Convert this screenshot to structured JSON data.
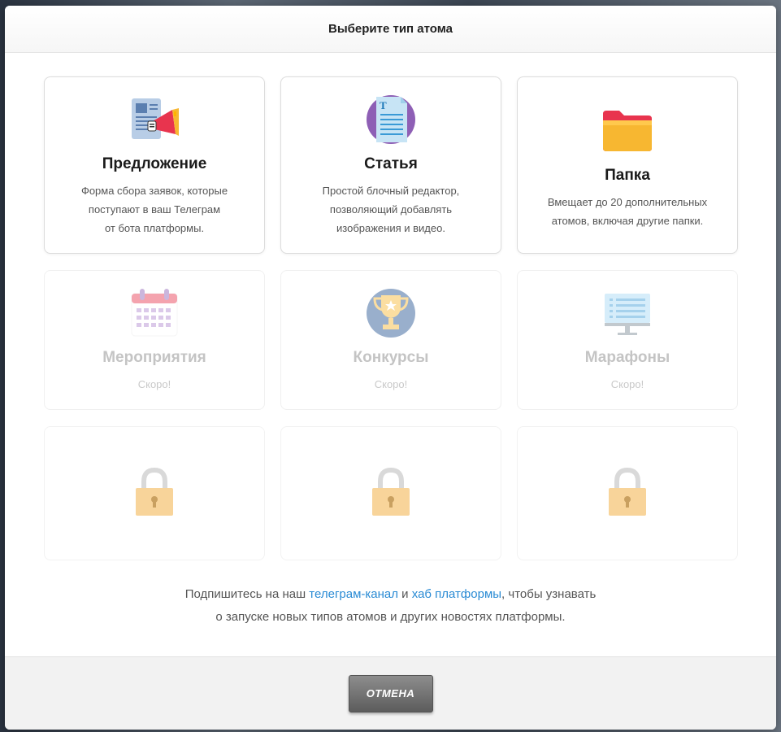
{
  "modal": {
    "title": "Выберите тип атома"
  },
  "cards": [
    {
      "title": "Предложение",
      "desc_lines": [
        "Форма сбора заявок, которые",
        "поступают в ваш Телеграм",
        "от бота платформы."
      ],
      "icon": "offer-megaphone-icon"
    },
    {
      "title": "Статья",
      "desc_lines": [
        "Простой блочный редактор,",
        "позволяющий добавлять",
        "изображения и видео."
      ],
      "icon": "article-document-icon"
    },
    {
      "title": "Папка",
      "desc_lines": [
        "Вмещает до 20 дополнительных",
        "атомов, включая другие папки."
      ],
      "icon": "folder-icon"
    },
    {
      "title": "Мероприятия",
      "desc_lines": [
        "Скоро!"
      ],
      "icon": "calendar-icon"
    },
    {
      "title": "Конкурсы",
      "desc_lines": [
        "Скоро!"
      ],
      "icon": "trophy-icon"
    },
    {
      "title": "Марафоны",
      "desc_lines": [
        "Скоро!"
      ],
      "icon": "monitor-icon"
    }
  ],
  "subscribe": {
    "prefix": "Подпишитесь на наш ",
    "link1": "телеграм-канал",
    "middle": " и ",
    "link2": "хаб платформы",
    "suffix": ", чтобы узнавать",
    "line2": "о запуске новых типов атомов и других новостях платформы."
  },
  "footer": {
    "cancel_label": "ОТМЕНА"
  },
  "colors": {
    "link": "#2a8bd4",
    "lock": "#f6c46a",
    "folder": "#f7b731"
  }
}
